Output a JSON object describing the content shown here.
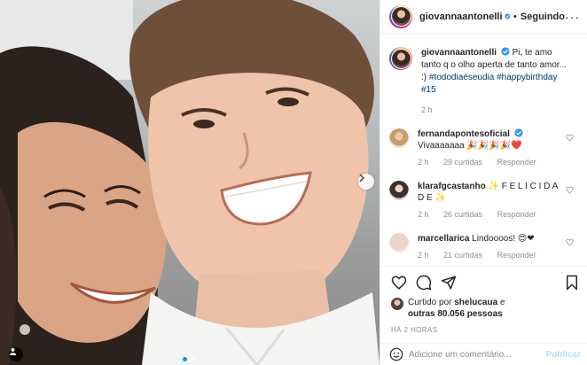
{
  "post": {
    "author": "giovannaantonelli",
    "follow_status": "Seguindo",
    "separator": "•",
    "caption_text": "Pi, te amo tanto q o olho aperta de tanto amor... :)",
    "hashtags": "#tododiaéseudia #happybirthday #15",
    "caption_time": "2 h"
  },
  "comments": [
    {
      "user": "fernandapontesoficial",
      "text": "Vivaaaaaaa 🎉🎉🎉🎉❤️",
      "time": "2 h",
      "likes": "29 curtidas",
      "reply": "Responder"
    },
    {
      "user": "klarafgcastanho",
      "text": "✨ F E L I C I D A D E ✨",
      "time": "2 h",
      "likes": "26 curtidas",
      "reply": "Responder"
    },
    {
      "user": "marcellarica",
      "text": "Lindoooos! 😍❤",
      "time": "2 h",
      "likes": "21 curtidas",
      "reply": "Responder"
    }
  ],
  "engagement": {
    "liked_prefix": "Curtido por",
    "liked_user": "shelucaua",
    "liked_suffix": " e",
    "liked_others": "outras 80.056 pessoas",
    "timestamp": "HÁ 2 HORAS"
  },
  "add_comment": {
    "placeholder": "Adicione um comentário...",
    "publish_label": "Publicar"
  },
  "carousel": {
    "slides": 2,
    "active_slide": 1
  },
  "icons": [
    "verified-badge-icon",
    "more-options-icon",
    "heart-icon",
    "comment-icon",
    "share-icon",
    "bookmark-icon",
    "emoji-icon",
    "chevron-right-icon",
    "user-tag-icon"
  ],
  "colors": {
    "accent": "#0095f6",
    "link": "#00376b",
    "muted": "#8e8e8e",
    "publish_disabled": "#b2dffc",
    "border": "#efefef"
  }
}
